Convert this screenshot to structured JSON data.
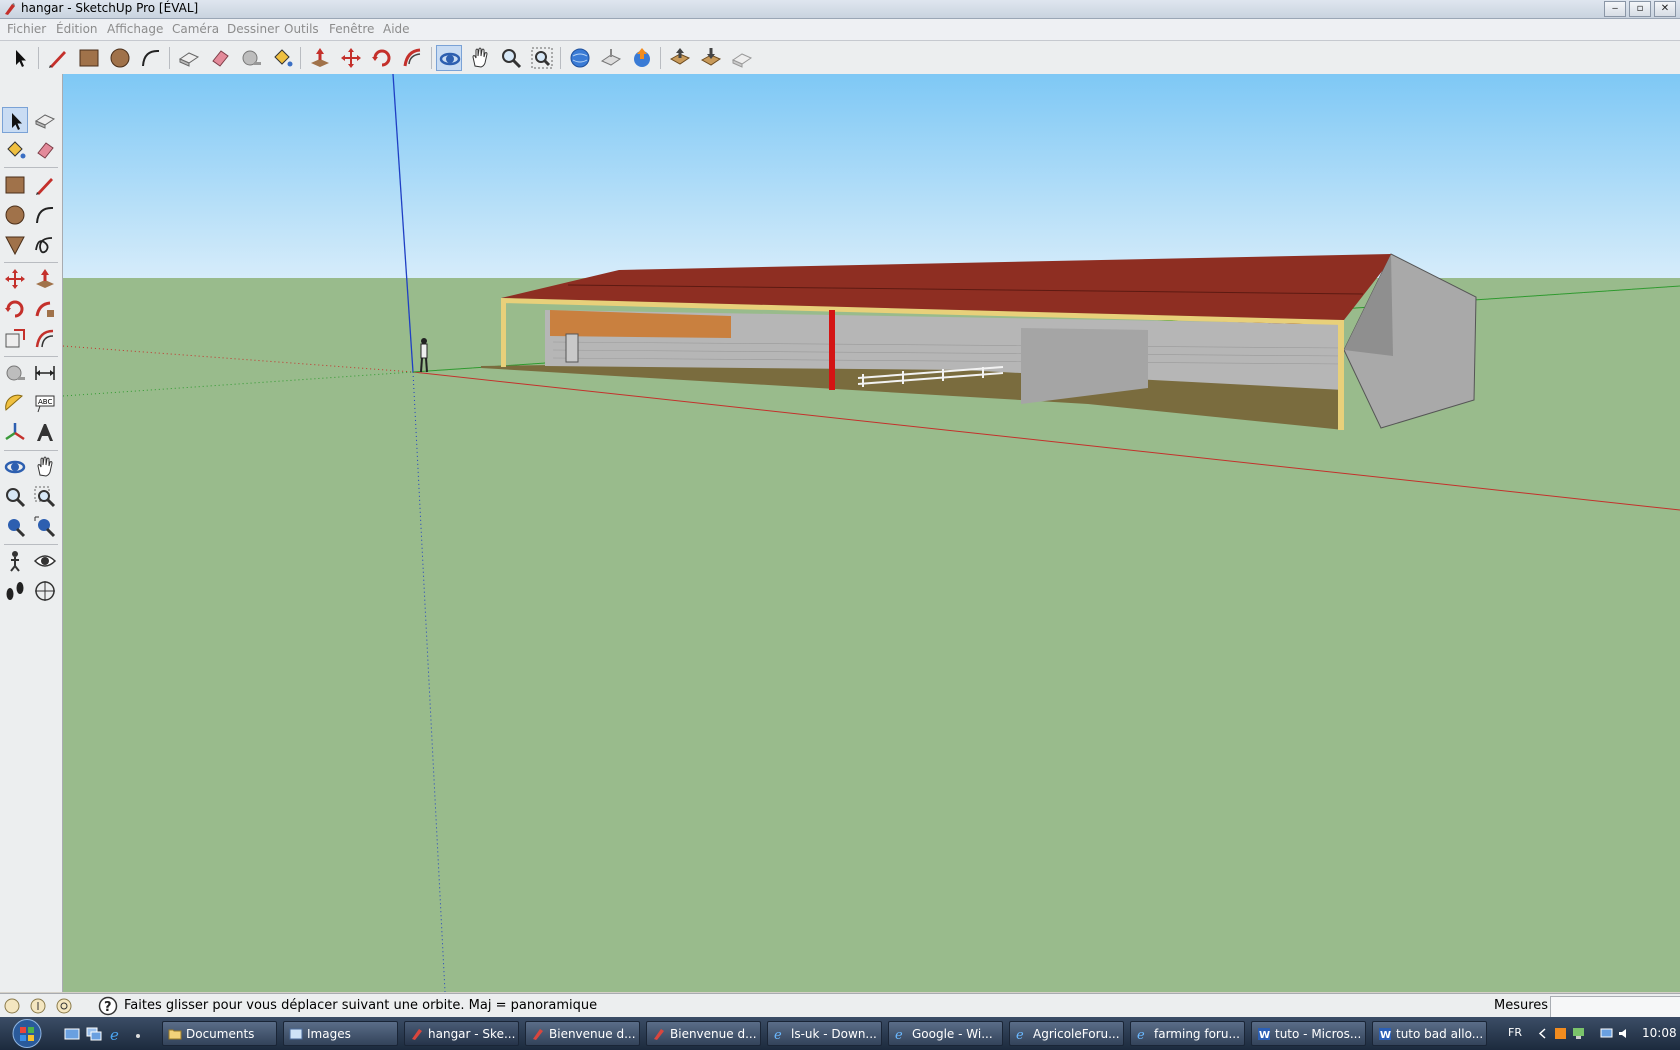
{
  "window": {
    "title": "hangar - SketchUp Pro [ÉVAL]",
    "controls": {
      "minimize": "‒",
      "maximize": "▫",
      "close": "✕"
    }
  },
  "menu": {
    "items": [
      "Fichier",
      "Édition",
      "Affichage",
      "Caméra",
      "Dessiner",
      "Outils",
      "Fenêtre",
      "Aide"
    ]
  },
  "toolbar": {
    "tools": [
      "select-icon",
      "pencil-icon",
      "rectangle-icon",
      "circle-icon",
      "arc-icon",
      "make-component-icon",
      "eraser-icon",
      "tape-measure-icon",
      "paint-bucket-icon",
      "push-pull-icon",
      "move-icon",
      "rotate-icon",
      "follow-me-icon",
      "orbit-icon",
      "pan-icon",
      "zoom-icon",
      "zoom-extents-icon",
      "get-models-icon",
      "share-model-icon",
      "warehouse-icon",
      "upload-icon",
      "download-icon",
      "extension-icon"
    ]
  },
  "leftbar": {
    "tools": [
      "select-icon",
      "make-component-icon",
      "paint-bucket-icon",
      "eraser-icon",
      "rectangle-icon",
      "pencil-icon",
      "circle-icon",
      "arc-icon",
      "polygon-icon",
      "freehand-icon",
      "move-icon",
      "push-pull-icon",
      "rotate-icon",
      "follow-me-icon",
      "scale-icon",
      "offset-icon",
      "tape-measure-icon",
      "dimension-icon",
      "protractor-icon",
      "text-icon",
      "axes-icon",
      "3d-text-icon",
      "orbit-icon",
      "pan-icon",
      "zoom-icon",
      "zoom-window-icon",
      "previous-view-icon",
      "zoom-extents-icon",
      "position-camera-icon",
      "look-around-icon",
      "walk-icon",
      "section-plane-icon"
    ]
  },
  "status": {
    "hint": "Faites glisser pour vous déplacer suivant une orbite.  Maj = panoramique",
    "mesures_label": "Mesures",
    "mesures_value": ""
  },
  "taskbar": {
    "items": [
      {
        "label": "Documents",
        "icon": "folder-icon"
      },
      {
        "label": "Images",
        "icon": "images-icon"
      },
      {
        "label": "hangar - Ske...",
        "icon": "sketchup-icon"
      },
      {
        "label": "Bienvenue d...",
        "icon": "sketchup-icon"
      },
      {
        "label": "Bienvenue d...",
        "icon": "sketchup-icon"
      },
      {
        "label": "ls-uk - Down...",
        "icon": "ie-icon"
      },
      {
        "label": "Google - Wi...",
        "icon": "ie-icon"
      },
      {
        "label": "AgricoleForu...",
        "icon": "ie-icon"
      },
      {
        "label": "farming foru...",
        "icon": "ie-icon"
      },
      {
        "label": "tuto - Micros...",
        "icon": "word-icon"
      },
      {
        "label": "tuto bad allo...",
        "icon": "word-icon"
      }
    ],
    "language": "FR",
    "clock": "10:08"
  },
  "colors": {
    "sky_top": "#7ec8f5",
    "sky_bottom": "#d6ecfa",
    "ground": "#99bb8c",
    "roof": "#8e2e22",
    "wall": "#b6b6b6",
    "beam": "#e8d07a",
    "floor": "#7a6c3e"
  }
}
